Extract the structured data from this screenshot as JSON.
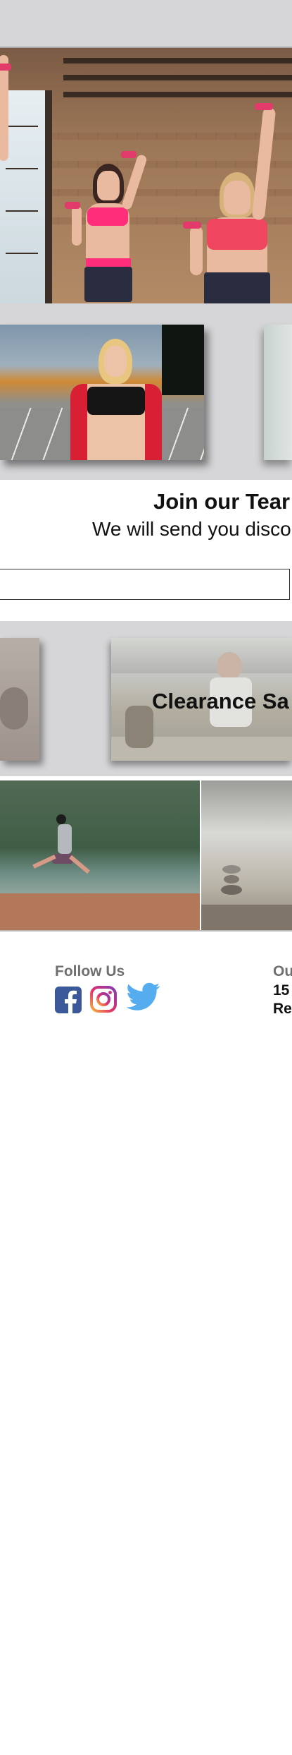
{
  "newsletter": {
    "title": "Join our Tear",
    "subtitle": "We will send you discou",
    "email_placeholder": ""
  },
  "promo": {
    "label": "Clearance Sa"
  },
  "footer": {
    "follow_label": "Follow Us",
    "social_icons": [
      "facebook-icon",
      "instagram-icon",
      "twitter-icon"
    ],
    "location_label": "Ou",
    "address_line1": "15",
    "address_line2": "Re"
  },
  "colors": {
    "band_grey": "#d6d6d8",
    "facebook": "#3b5998",
    "twitter": "#1da1f2",
    "muted_text": "#6f6f6f"
  }
}
